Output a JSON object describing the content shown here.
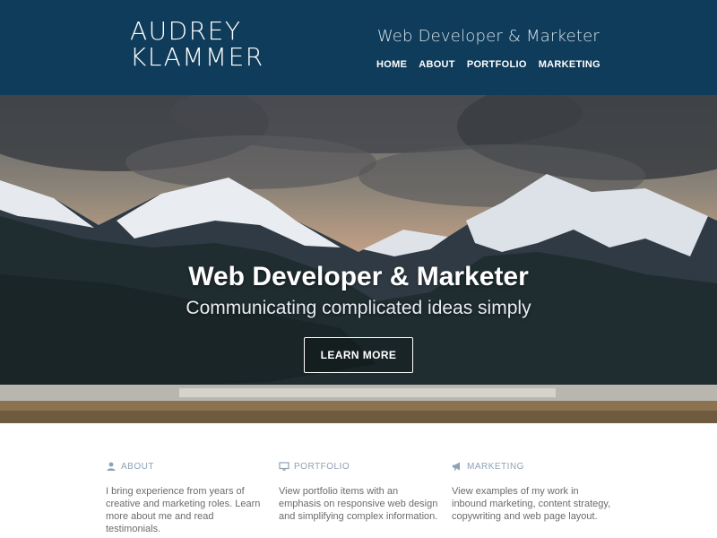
{
  "header": {
    "logo_line1": "AUDREY",
    "logo_line2": "KLAMMER",
    "tagline": "Web Developer & Marketer",
    "nav": [
      {
        "label": "HOME"
      },
      {
        "label": "ABOUT"
      },
      {
        "label": "PORTFOLIO"
      },
      {
        "label": "MARKETING"
      }
    ]
  },
  "hero": {
    "title": "Web Developer & Marketer",
    "subtitle": "Communicating complicated ideas simply",
    "button_label": "LEARN MORE"
  },
  "features": [
    {
      "icon": "user-icon",
      "title": "ABOUT",
      "text": "I bring experience from years of creative and marketing roles. Learn more about me and read testimonials."
    },
    {
      "icon": "monitor-icon",
      "title": "PORTFOLIO",
      "text": "View portfolio items with an emphasis on responsive web design and simplifying complex information."
    },
    {
      "icon": "megaphone-icon",
      "title": "MARKETING",
      "text": "View examples of my work in inbound marketing, content strategy, copywriting and web page layout."
    }
  ],
  "colors": {
    "header_bg": "#0f3c5a",
    "feature_heading": "#8ca2b5",
    "body_text": "#6b6b6b"
  }
}
